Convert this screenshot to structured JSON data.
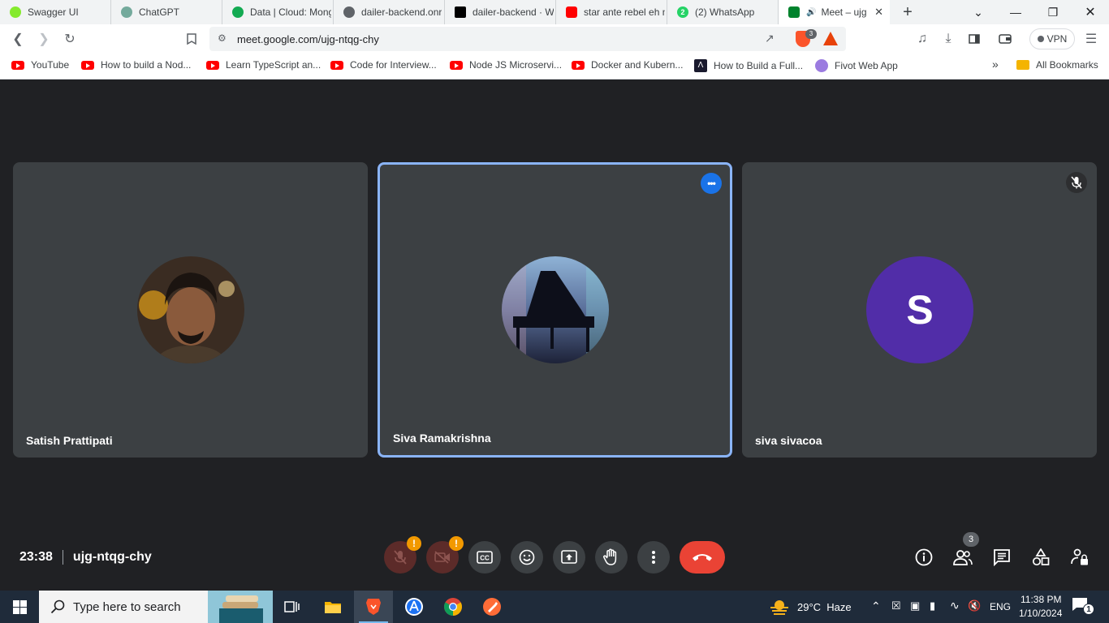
{
  "browser": {
    "tabs": [
      {
        "title": "Swagger UI",
        "icon": "swagger-icon",
        "color": "#85ea2d"
      },
      {
        "title": "ChatGPT",
        "icon": "chatgpt-icon",
        "color": "#74aa9c"
      },
      {
        "title": "Data | Cloud: Mong",
        "icon": "mongodb-icon",
        "color": "#13aa52"
      },
      {
        "title": "dailer-backend.onr",
        "icon": "globe-icon",
        "color": "#5f6368"
      },
      {
        "title": "dailer-backend · W",
        "icon": "render-icon",
        "color": "#000000"
      },
      {
        "title": "star ante rebel eh n",
        "icon": "youtube-icon",
        "color": "#ff0000"
      },
      {
        "title": "(2) WhatsApp",
        "icon": "whatsapp-icon",
        "color": "#25d366",
        "badge": "2"
      },
      {
        "title": "Meet – ujg",
        "icon": "google-meet-icon",
        "color": "#00832d",
        "active": true,
        "close": "✕"
      }
    ],
    "new_tab": "+",
    "url": "meet.google.com/ujg-ntqg-chy",
    "brave_badge": "3",
    "vpn_label": "VPN",
    "bookmarks": [
      {
        "label": "YouTube",
        "icon": "youtube-icon"
      },
      {
        "label": "How to build a Nod...",
        "icon": "youtube-icon"
      },
      {
        "label": "Learn TypeScript an...",
        "icon": "youtube-icon"
      },
      {
        "label": "Code for Interview...",
        "icon": "youtube-icon"
      },
      {
        "label": "Node JS Microservi...",
        "icon": "youtube-icon"
      },
      {
        "label": "Docker and Kubern...",
        "icon": "youtube-icon"
      },
      {
        "label": "How to Build a Full...",
        "icon": "dev-icon"
      },
      {
        "label": "Fivot Web App",
        "icon": "fivot-icon"
      }
    ],
    "overflow": "»",
    "all_bookmarks": "All Bookmarks"
  },
  "meet": {
    "participants": [
      {
        "name": "Satish Prattipati",
        "avatar": "photo"
      },
      {
        "name": "Siva Ramakrishna",
        "avatar": "piano-photo",
        "speaking": true
      },
      {
        "name": "siva sivacoa",
        "avatar": "initial",
        "initial": "S",
        "avatar_color": "#512da8",
        "muted": true
      }
    ],
    "time": "23:38",
    "meeting_code": "ujg-ntqg-chy",
    "people_count": "3",
    "warn_mark": "!"
  },
  "taskbar": {
    "search_placeholder": "Type here to search",
    "weather": "29°C  Haze",
    "language": "ENG",
    "time": "11:38 PM",
    "date": "1/10/2024",
    "notification_count": "1"
  },
  "colors": {
    "meet_bg": "#202124",
    "tile_bg": "#3c4043",
    "speaking_border": "#8ab4f8",
    "hangup": "#ea4335",
    "warning": "#f29900"
  }
}
